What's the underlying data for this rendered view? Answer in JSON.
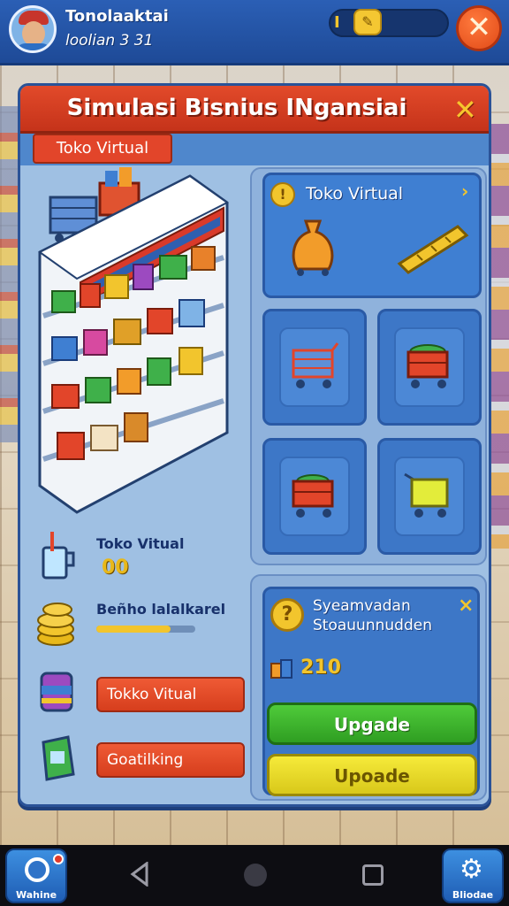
{
  "topbar": {
    "player_name": "Tonolaaktai",
    "player_level": "loolian 3 31",
    "currency_badge": "I",
    "currency_icon": "chat-coin-icon",
    "close_icon": "close-icon"
  },
  "panel": {
    "title": "Simulasi Bisnius INgansiai",
    "close_icon": "close-icon",
    "active_tab": "Toko Virtual"
  },
  "left": {
    "stats": [
      {
        "label": "Toko Vitual",
        "value": "00",
        "icon": "cup-icon"
      },
      {
        "label": "Beñho lalalkarel",
        "progress": 0.75,
        "icon": "coins-icon"
      }
    ],
    "buttons": [
      {
        "label": "Tokko Vitual",
        "icon": "cloth-icon"
      },
      {
        "label": "Goatilking",
        "icon": "bag-icon"
      }
    ]
  },
  "right": {
    "feature": {
      "title": "Toko Virtual",
      "badge": "!",
      "arrow": "›"
    },
    "carts": [
      {
        "name": "blue-cart"
      },
      {
        "name": "red-cart-green-goods"
      },
      {
        "name": "red-cart-goods"
      },
      {
        "name": "yellow-cart"
      }
    ],
    "info": {
      "title_line1": "Syeamvadan",
      "title_line2": "Stoauunnudden",
      "badge": "?",
      "close": "×",
      "cost": "210",
      "upgrade_green": "Upgade",
      "upgrade_yellow": "Upoade"
    }
  },
  "navbar": {
    "left_label": "Wahine",
    "right_label": "Bliodae"
  },
  "colors": {
    "header_red": "#e24a2a",
    "panel_blue": "#3d77c7",
    "gold": "#f2c52d",
    "green_button": "#4fcb3a",
    "yellow_button": "#f6ea3a"
  }
}
